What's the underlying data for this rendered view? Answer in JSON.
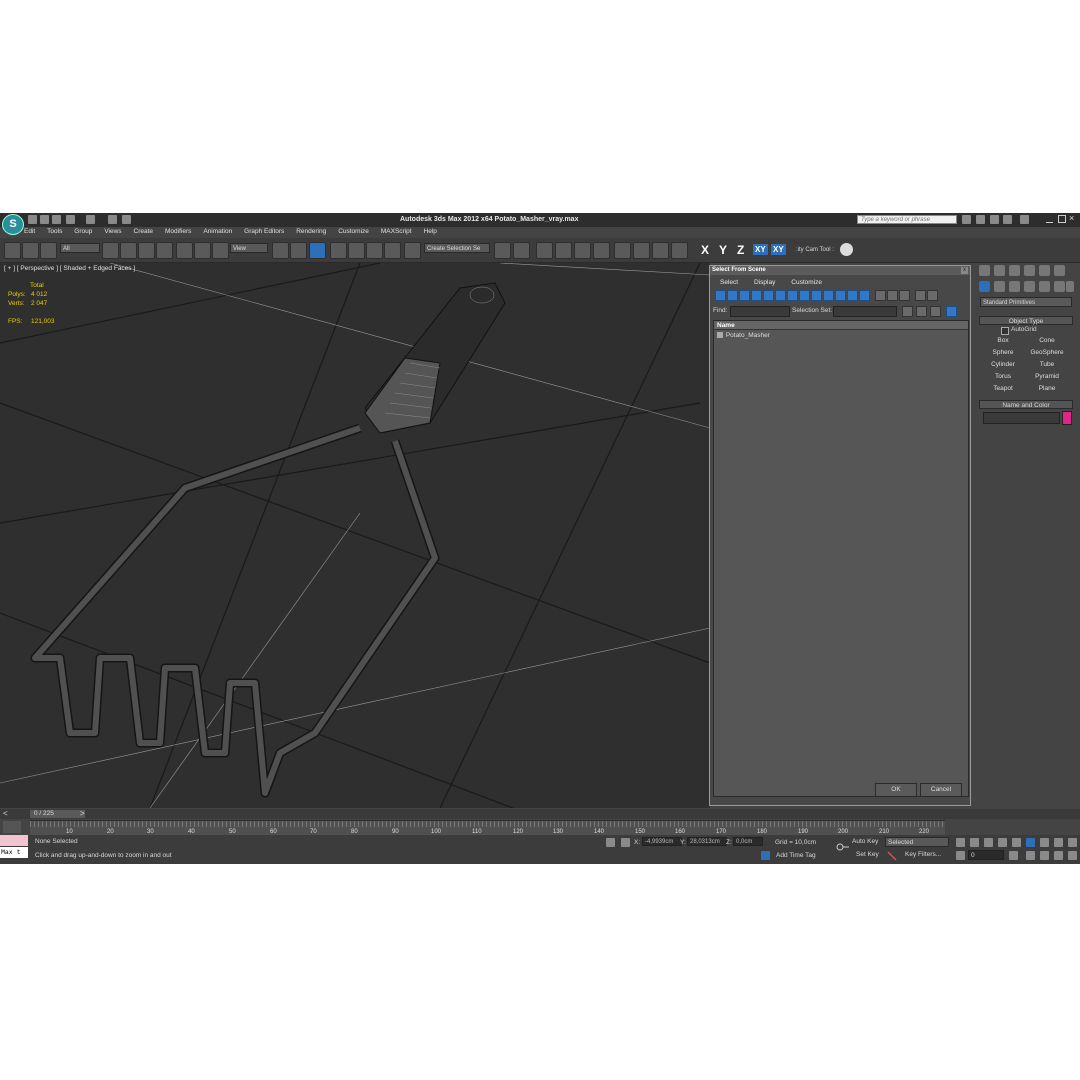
{
  "titlebar": {
    "logo": "S",
    "title": "Autodesk 3ds Max  2012 x64    Potato_Masher_vray.max",
    "search_placeholder": "Type a keyword or phrase"
  },
  "menu": [
    "Edit",
    "Tools",
    "Group",
    "Views",
    "Create",
    "Modifiers",
    "Animation",
    "Graph Editors",
    "Rendering",
    "Customize",
    "MAXScript",
    "Help"
  ],
  "toolbar": {
    "filter_dropdown": "All",
    "ref_coord_dropdown": "View",
    "named_selection": "Create Selection Se",
    "axis_x": "X",
    "axis_y": "Y",
    "axis_z": "Z",
    "axis_xy": "XY",
    "axis_xy2": "XY",
    "tool_label": ":ity Cam Tool :"
  },
  "viewport": {
    "label": "[ + ] [ Perspective ] [ Shaded + Edged Faces ]",
    "stats": {
      "total_label": "Total",
      "polys_label": "Polys:",
      "polys_value": "4 012",
      "verts_label": "Verts:",
      "verts_value": "2 047",
      "fps_label": "FPS:",
      "fps_value": "121,003"
    }
  },
  "dialog": {
    "title": "Select From Scene",
    "close": "x",
    "menu": [
      "Select",
      "Display",
      "Customize"
    ],
    "find_label": "Find:",
    "selection_set_label": "Selection Set:",
    "column_name": "Name",
    "items": [
      "Potato_Masher"
    ],
    "ok": "OK",
    "cancel": "Cancel"
  },
  "command_panel": {
    "category": "Standard Primitives",
    "object_type_title": "Object Type",
    "autogrid": "AutoGrid",
    "primitives": [
      "Box",
      "Cone",
      "Sphere",
      "GeoSphere",
      "Cylinder",
      "Tube",
      "Torus",
      "Pyramid",
      "Teapot",
      "Plane"
    ],
    "name_color_title": "Name and Color",
    "color": "#e0248a"
  },
  "timeline": {
    "counter": "0 / 225",
    "ticks": [
      "10",
      "20",
      "30",
      "40",
      "50",
      "60",
      "70",
      "80",
      "90",
      "100",
      "110",
      "120",
      "130",
      "140",
      "150",
      "160",
      "170",
      "180",
      "190",
      "200",
      "210",
      "220"
    ]
  },
  "statusbar": {
    "script_text": "Max t",
    "selection_status": "None Selected",
    "prompt": "Click and drag up-and-down to zoom in and out",
    "x_label": "X:",
    "x_value": "-4,9939cm",
    "y_label": "Y:",
    "y_value": "28,0313cm",
    "z_label": "Z:",
    "z_value": "0,0cm",
    "grid": "Grid = 10,0cm",
    "add_time_tag": "Add Time Tag",
    "auto_key": "Auto Key",
    "set_key": "Set Key",
    "selected": "Selected",
    "key_filters": "Key Filters...",
    "frame": "0"
  }
}
